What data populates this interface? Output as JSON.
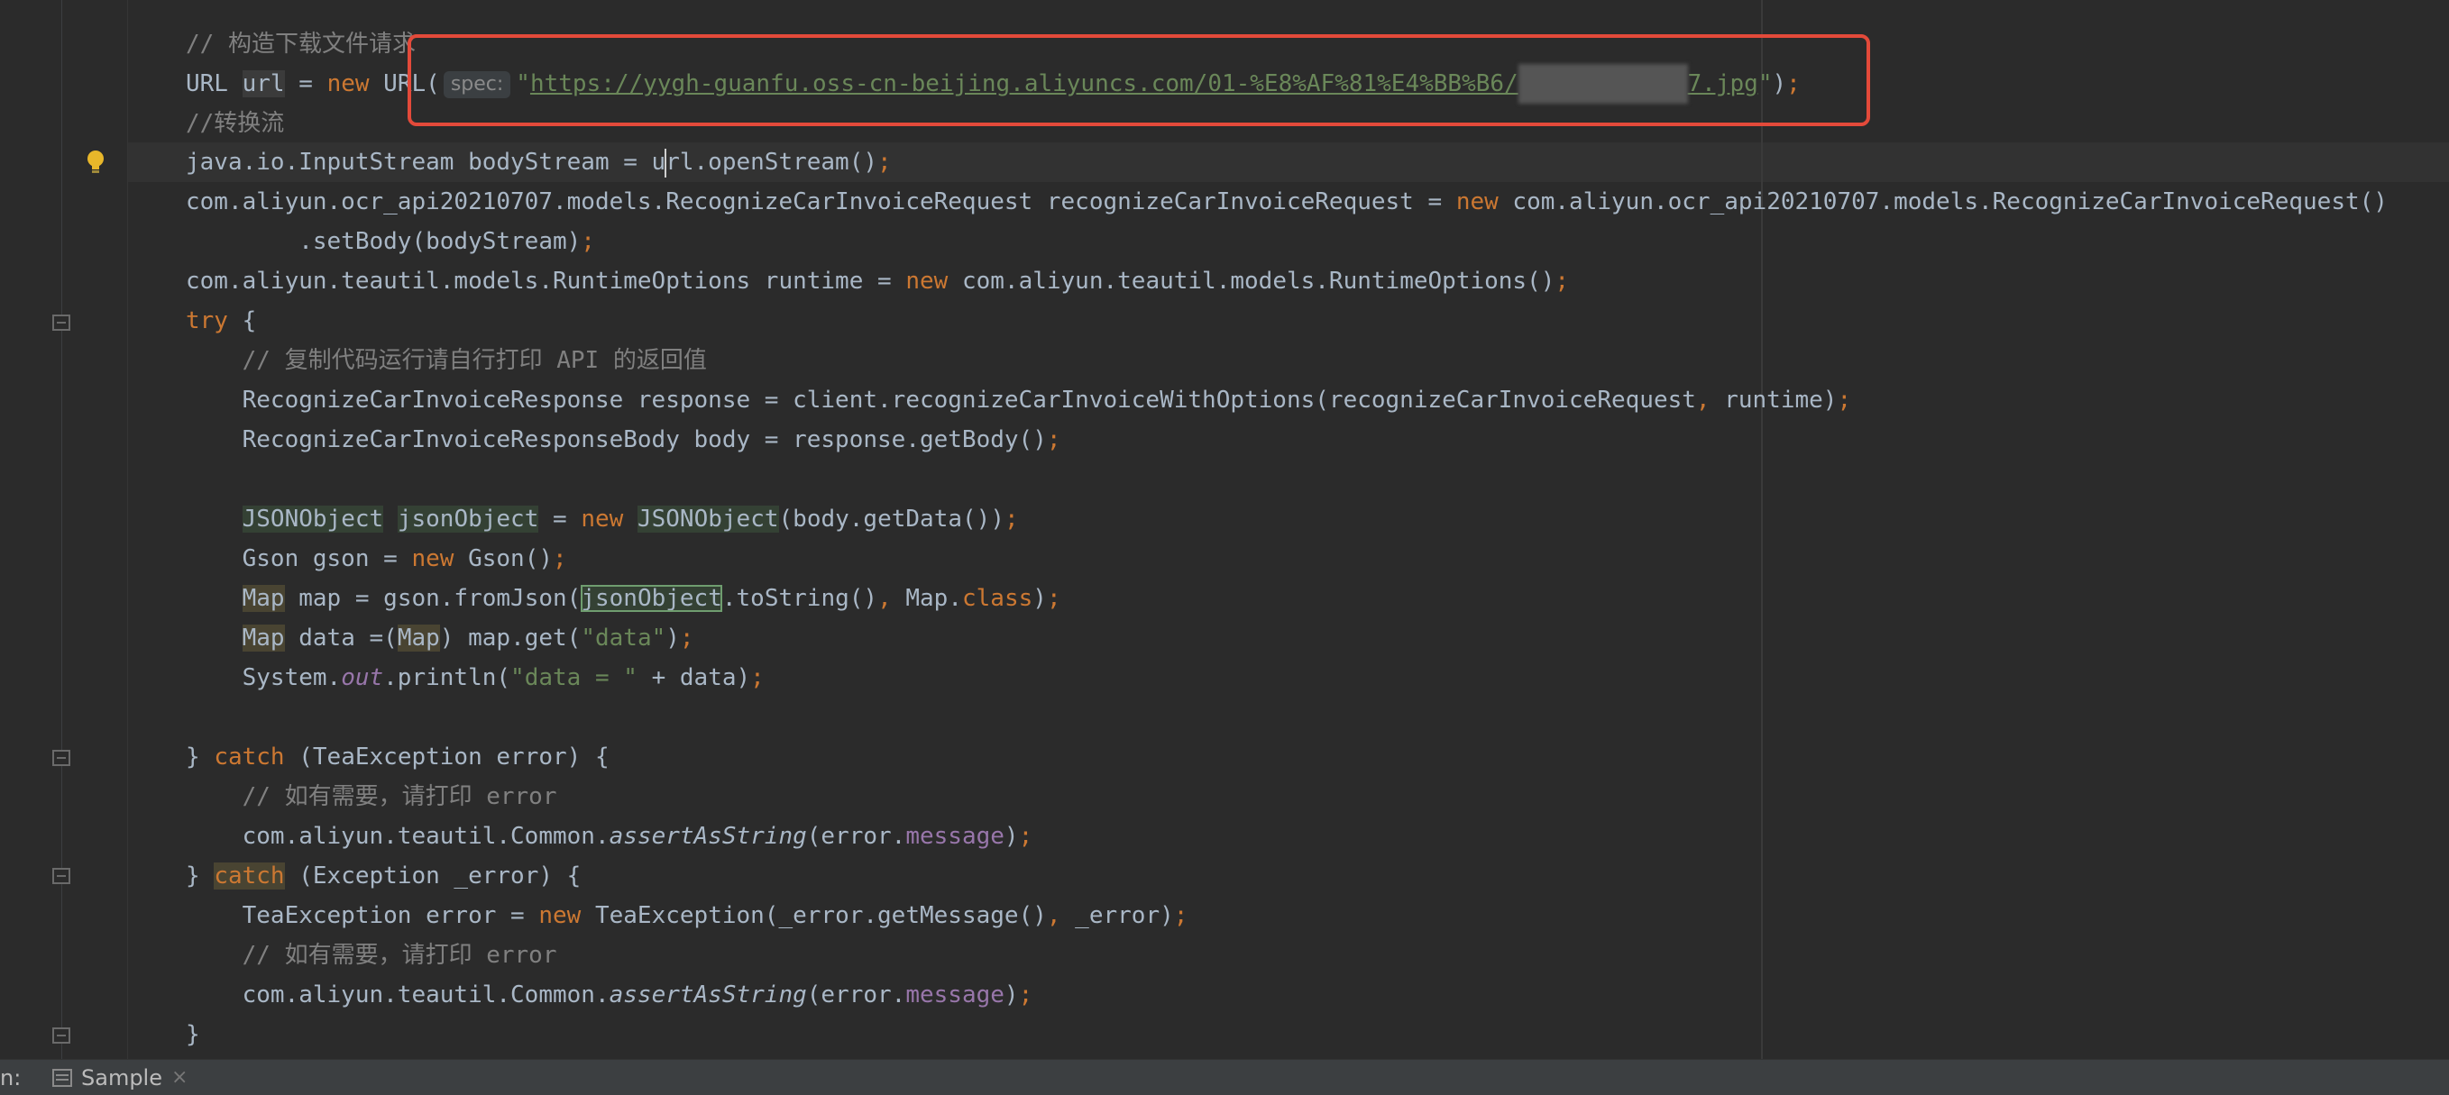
{
  "editor": {
    "lines": {
      "l01": {
        "comment": "// 构造下载文件请求"
      },
      "l02": {
        "type": "URL",
        "var": "url",
        "eq": " = ",
        "new": "new",
        "ctor": " URL(",
        "hint": "spec:",
        "q1": "\"",
        "url": "https://yygh-guanfu.oss-cn-beijing.aliyuncs.com/01-%E8%AF%81%E4%BB%B6/",
        "blurred": "xxxxxxxxxxxx",
        "ext": "7.jpg",
        "q2": "\"",
        "close": ")",
        "semi": ";"
      },
      "l03": {
        "comment": "//转换流"
      },
      "l04": {
        "a": "java.io.InputStream bodyStream = u",
        "b": "rl.openStream()",
        "semi": ";"
      },
      "l05": {
        "a": "com.aliyun.ocr_api20210707.models.RecognizeCarInvoiceRequest recognizeCarInvoiceRequest = ",
        "new": "new",
        "b": " com.aliyun.ocr_api20210707.models.RecognizeCarInvoiceRequest()"
      },
      "l06": {
        "a": "        .setBody(bodyStream)",
        "semi": ";"
      },
      "l07": {
        "a": "com.aliyun.teautil.models.RuntimeOptions runtime = ",
        "new": "new",
        "b": " com.aliyun.teautil.models.RuntimeOptions()",
        "semi": ";"
      },
      "l08": {
        "try": "try",
        "b": " {"
      },
      "l09": {
        "comment": "    // 复制代码运行请自行打印 API 的返回值"
      },
      "l10": {
        "a": "    RecognizeCarInvoiceResponse response = client.recognizeCarInvoiceWithOptions(recognizeCarInvoiceRequest",
        "comma": ",",
        "b": " runtime)",
        "semi": ";"
      },
      "l11": {
        "a": "    RecognizeCarInvoiceResponseBody body = response.getBody()",
        "semi": ";"
      },
      "l12": {
        "indent": "    ",
        "t1": "JSONObject",
        "sp": " ",
        "t2": "jsonObject",
        "eq": " = ",
        "new": "new",
        "sp2": " ",
        "t3": "JSONObject",
        "b": "(body.getData())",
        "semi": ";"
      },
      "l13": {
        "a": "    Gson gson = ",
        "new": "new",
        "b": " Gson()",
        "semi": ";"
      },
      "l14": {
        "indent": "    ",
        "map": "Map",
        "a": " map = gson.fromJson(",
        "jo": "jsonObject",
        "b": ".toString()",
        "comma": ",",
        "c": " Map.",
        "cls": "class",
        "d": ")",
        "semi": ";"
      },
      "l15": {
        "indent": "    ",
        "map": "Map",
        "a": " data =(",
        "map2": "Map",
        "b": ") map.get(",
        "str": "\"data\"",
        "c": ")",
        "semi": ";"
      },
      "l16": {
        "a": "    System.",
        "out": "out",
        "b": ".println(",
        "str": "\"data = \"",
        "c": " + data)",
        "semi": ";"
      },
      "l17": {
        "a": "} ",
        "catch": "catch",
        "b": " (TeaException error) {"
      },
      "l18": {
        "comment": "    // 如有需要，请打印 error"
      },
      "l19": {
        "a": "    com.aliyun.teautil.Common.",
        "m": "assertAsString",
        "b": "(error.",
        "f": "message",
        "c": ")",
        "semi": ";"
      },
      "l20": {
        "a": "} ",
        "catch": "catch",
        "b": " (Exception _error) {"
      },
      "l21": {
        "a": "    TeaException error = ",
        "new": "new",
        "b": " TeaException(_error.getMessage()",
        "comma": ",",
        "c": " _error)",
        "semi": ";"
      },
      "l22": {
        "comment": "    // 如有需要，请打印 error"
      },
      "l23": {
        "a": "    com.aliyun.teautil.Common.",
        "m": "assertAsString",
        "b": "(error.",
        "f": "message",
        "c": ")",
        "semi": ";"
      },
      "l24": {
        "a": "}"
      }
    }
  },
  "bottom": {
    "run_label": "n:",
    "tab_label": "Sample",
    "close": "×"
  },
  "colors": {
    "highlight_box": "#e34a3a",
    "background": "#2b2b2b",
    "keyword": "#cc7832",
    "string": "#6a8759"
  }
}
